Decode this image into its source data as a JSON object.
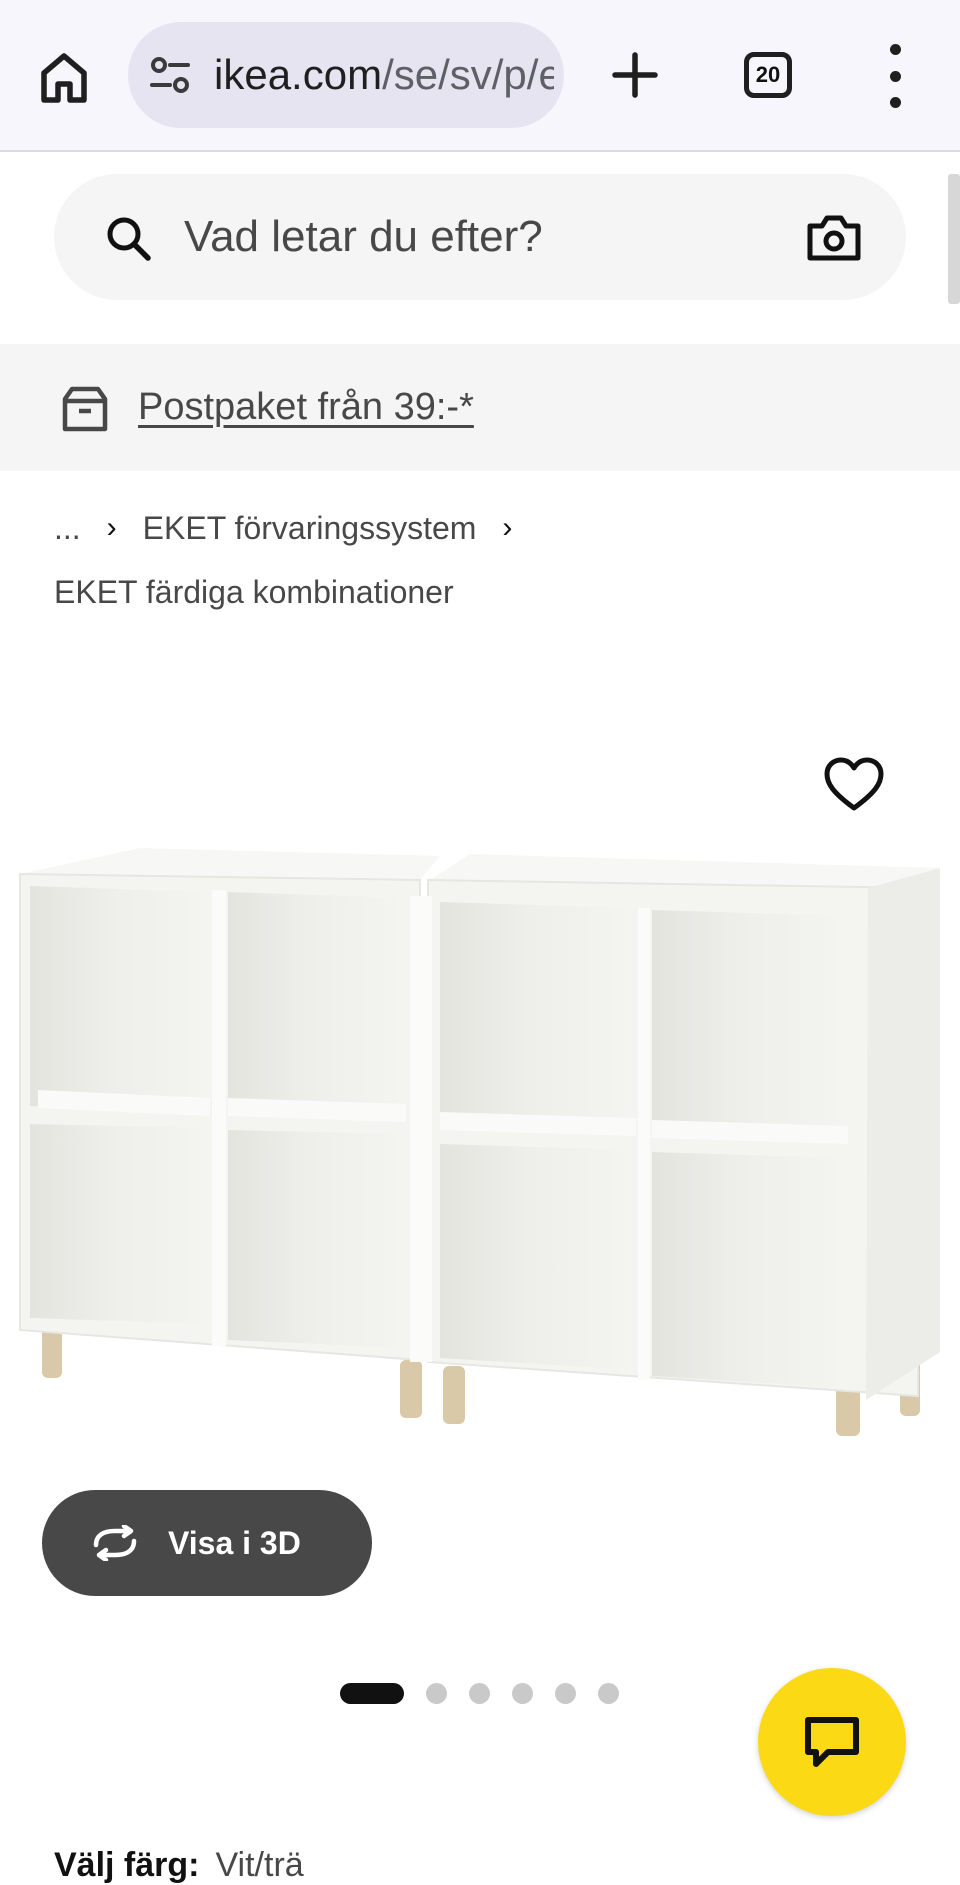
{
  "browser": {
    "url_host": "ikea.com",
    "url_path": "/se/sv/p/e",
    "tab_count": "20"
  },
  "search": {
    "placeholder": "Vad letar du efter?"
  },
  "promo": {
    "text": "Postpaket från 39:-*"
  },
  "breadcrumb": {
    "ellipsis": "...",
    "level1": "EKET förvaringssystem",
    "level2": "EKET färdiga kombinationer"
  },
  "product": {
    "view3d_label": "Visa i 3D",
    "gallery_total": 6,
    "gallery_active": 1
  },
  "color": {
    "label": "Välj färg:",
    "value": "Vit/trä"
  },
  "colors": {
    "chat_button": "#fbd914",
    "view3d_bg": "#484848",
    "promo_bg": "#f5f5f5"
  }
}
